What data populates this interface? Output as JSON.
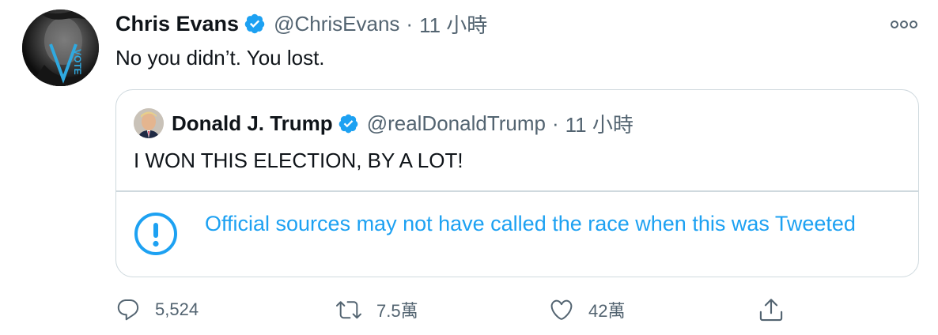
{
  "tweet": {
    "author_name": "Chris Evans",
    "handle": "@ChrisEvans",
    "separator": "·",
    "time": "11 小時",
    "text": "No you didn’t. You lost.",
    "avatar_text": "VOTE"
  },
  "quoted": {
    "author_name": "Donald J. Trump",
    "handle": "@realDonaldTrump",
    "separator": "·",
    "time": "11 小時",
    "text": "I WON THIS ELECTION, BY A LOT!",
    "notice": "Official sources may not have called the race when this was Tweeted"
  },
  "actions": {
    "reply_count": "5,524",
    "retweet_count": "7.5萬",
    "like_count": "42萬"
  },
  "colors": {
    "verified": "#1da1f2",
    "notice_text": "#1da1f2",
    "secondary_text": "#536471",
    "border": "#cfd9de"
  },
  "icons": {
    "more": "more-icon",
    "verified": "verified-badge-icon",
    "notice": "exclamation-circle-icon",
    "reply": "reply-icon",
    "retweet": "retweet-icon",
    "like": "heart-icon",
    "share": "share-icon"
  }
}
